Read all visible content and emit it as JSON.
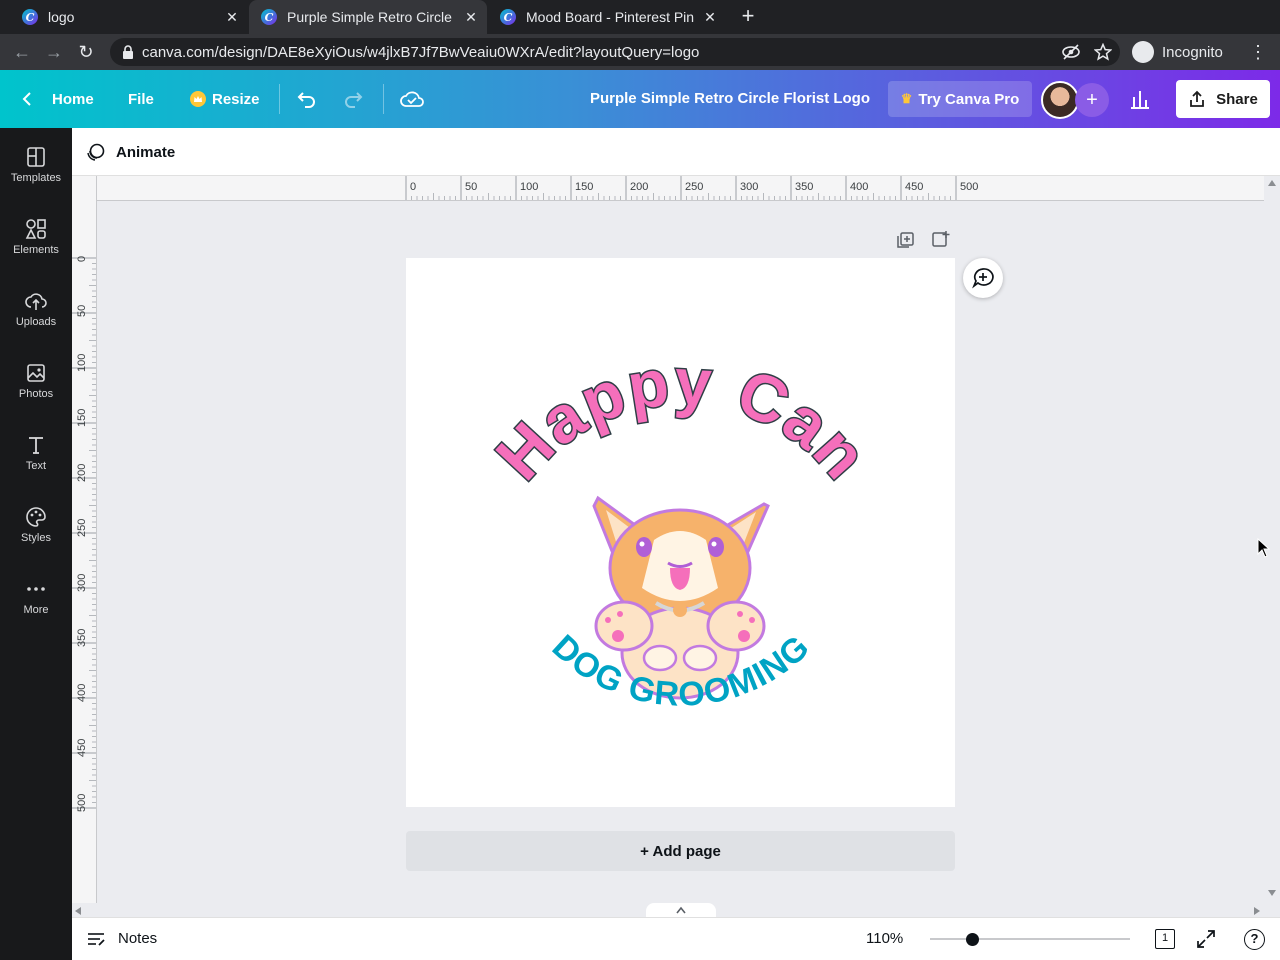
{
  "browser": {
    "tabs": [
      {
        "title": "logo",
        "active": false
      },
      {
        "title": "Purple Simple Retro Circle",
        "active": true
      },
      {
        "title": "Mood Board - Pinterest Pin",
        "active": false
      }
    ],
    "url": "canva.com/design/DAE8eXyiOus/w4jlxB7Jf7BwVeaiu0WXrA/edit?layoutQuery=logo",
    "incognito_label": "Incognito"
  },
  "header": {
    "home": "Home",
    "file": "File",
    "resize": "Resize",
    "title": "Purple Simple Retro Circle Florist Logo",
    "try_pro": "Try Canva Pro",
    "share": "Share"
  },
  "sidebar": {
    "items": [
      {
        "label": "Templates",
        "icon": "templates-icon"
      },
      {
        "label": "Elements",
        "icon": "elements-icon"
      },
      {
        "label": "Uploads",
        "icon": "uploads-icon"
      },
      {
        "label": "Photos",
        "icon": "photos-icon"
      },
      {
        "label": "Text",
        "icon": "text-icon"
      },
      {
        "label": "Styles",
        "icon": "styles-icon"
      },
      {
        "label": "More",
        "icon": "more-icon"
      }
    ]
  },
  "toolbar": {
    "animate": "Animate"
  },
  "rulers": {
    "horizontal": [
      "0",
      "50",
      "100",
      "150",
      "200",
      "250",
      "300",
      "350",
      "400",
      "450",
      "500"
    ],
    "vertical": [
      "0",
      "50",
      "100",
      "150",
      "200",
      "250",
      "300",
      "350",
      "400",
      "450",
      "500"
    ]
  },
  "design": {
    "headline": "Happy Can",
    "tagline": "DOG GROOMING",
    "colors": {
      "pink": "#f56fbb",
      "outline": "#2f3e46",
      "teal": "#00a3c4",
      "orange": "#f6b26b",
      "purple": "#c27ae0"
    }
  },
  "canvas": {
    "add_page": "+ Add page"
  },
  "footer": {
    "notes": "Notes",
    "zoom": "110%",
    "zoom_level": 0.21,
    "page_count": "1"
  },
  "colors": {
    "sidebar_bg": "#18191b",
    "accent": "#7d2ae8"
  }
}
